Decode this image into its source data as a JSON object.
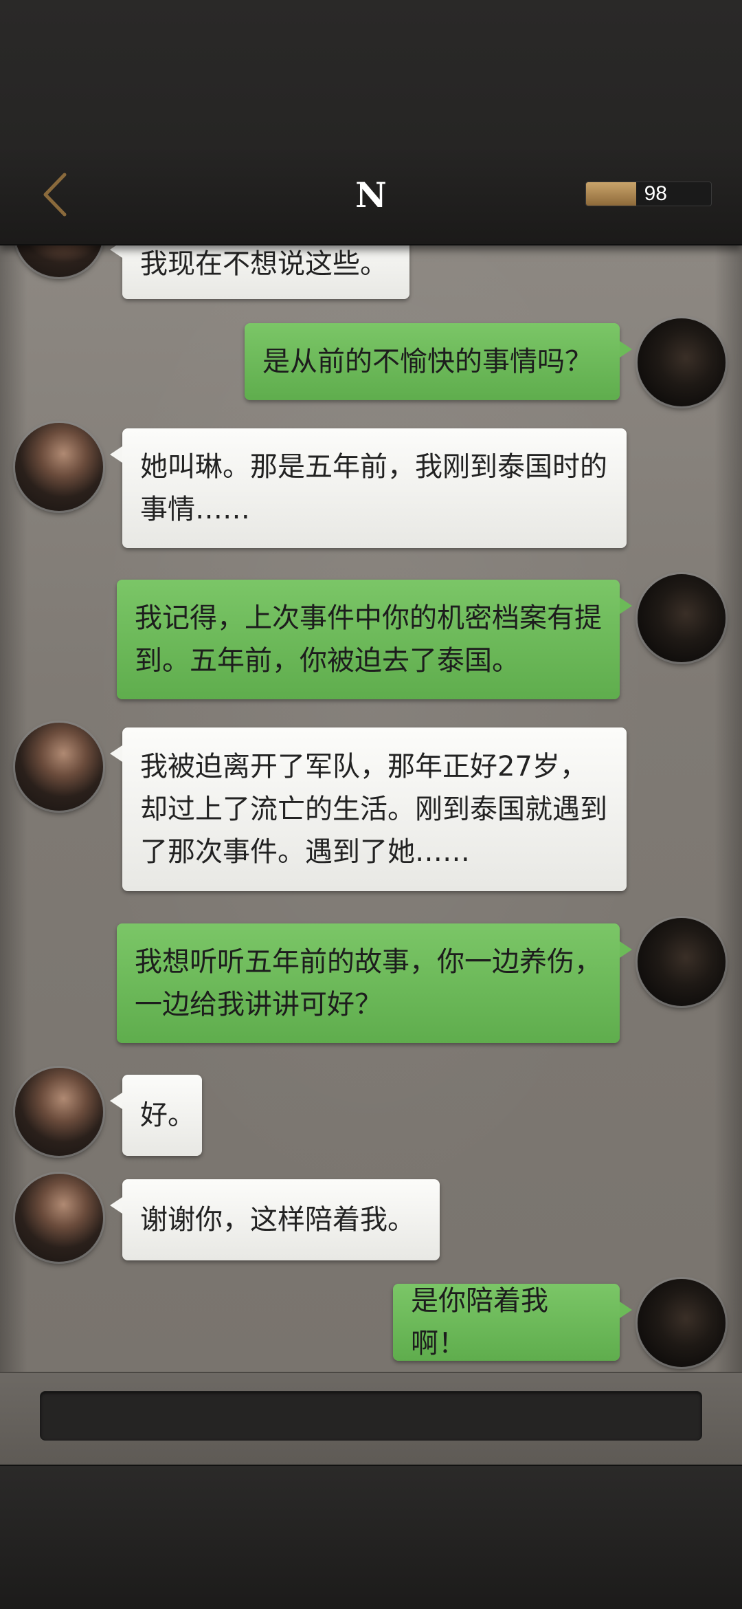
{
  "header": {
    "title": "N",
    "meter_value": "98",
    "meter_fill_fraction": 0.4
  },
  "messages": [
    {
      "side": "npc",
      "text": "我现在不想说这些。"
    },
    {
      "side": "me",
      "text": "是从前的不愉快的事情吗？"
    },
    {
      "side": "npc",
      "text": "她叫琳。那是五年前，我刚到泰国时的事情……"
    },
    {
      "side": "me",
      "text": "我记得，上次事件中你的机密档案有提到。五年前，你被迫去了泰国。"
    },
    {
      "side": "npc",
      "text": "我被迫离开了军队，那年正好27岁，却过上了流亡的生活。刚到泰国就遇到了那次事件。遇到了她……"
    },
    {
      "side": "me",
      "text": "我想听听五年前的故事，你一边养伤，一边给我讲讲可好？"
    },
    {
      "side": "npc",
      "text": "好。"
    },
    {
      "side": "npc",
      "text": "谢谢你，这样陪着我。"
    },
    {
      "side": "me",
      "text": "是你陪着我啊！"
    }
  ],
  "input": {
    "value": ""
  },
  "colors": {
    "player_bubble": "#6cbb58",
    "npc_bubble": "#f2f2ef",
    "header_bg": "#262524",
    "chat_bg": "#837e78",
    "meter_fill": "#b08a55"
  },
  "icons": {
    "back": "chevron-left-icon"
  }
}
